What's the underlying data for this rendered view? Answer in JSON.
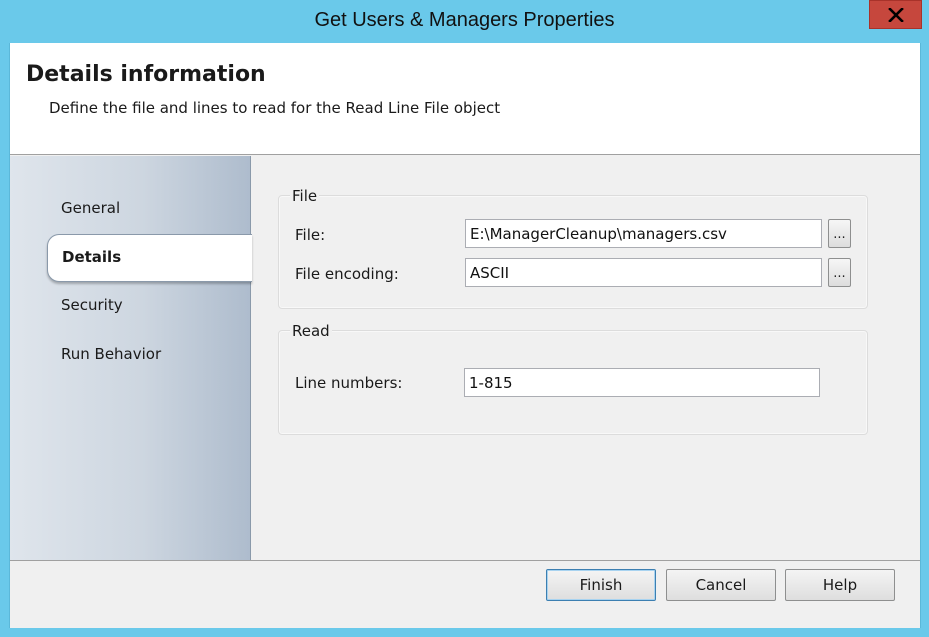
{
  "window": {
    "title": "Get Users & Managers Properties",
    "close_symbol": "X"
  },
  "header": {
    "title": "Details information",
    "subtitle": "Define the file and lines to read for the Read Line File object"
  },
  "sidebar": {
    "items": [
      {
        "label": "General",
        "selected": false
      },
      {
        "label": "Details",
        "selected": true
      },
      {
        "label": "Security",
        "selected": false
      },
      {
        "label": "Run Behavior",
        "selected": false
      }
    ]
  },
  "file_group": {
    "legend": "File",
    "file_label": "File:",
    "file_value": "E:\\ManagerCleanup\\managers.csv",
    "encoding_label": "File encoding:",
    "encoding_value": "ASCII",
    "browse_label": "..."
  },
  "read_group": {
    "legend": "Read",
    "lines_label": "Line numbers:",
    "lines_value": "1-815"
  },
  "footer": {
    "finish_label": "Finish",
    "cancel_label": "Cancel",
    "help_label": "Help"
  },
  "colors": {
    "titlebar": "#6ac9ea",
    "close_button": "#c6473d",
    "sidebar_gradient_end": "#aebccd"
  },
  "icons": {
    "close": "close-icon",
    "browse": "ellipsis-icon"
  }
}
